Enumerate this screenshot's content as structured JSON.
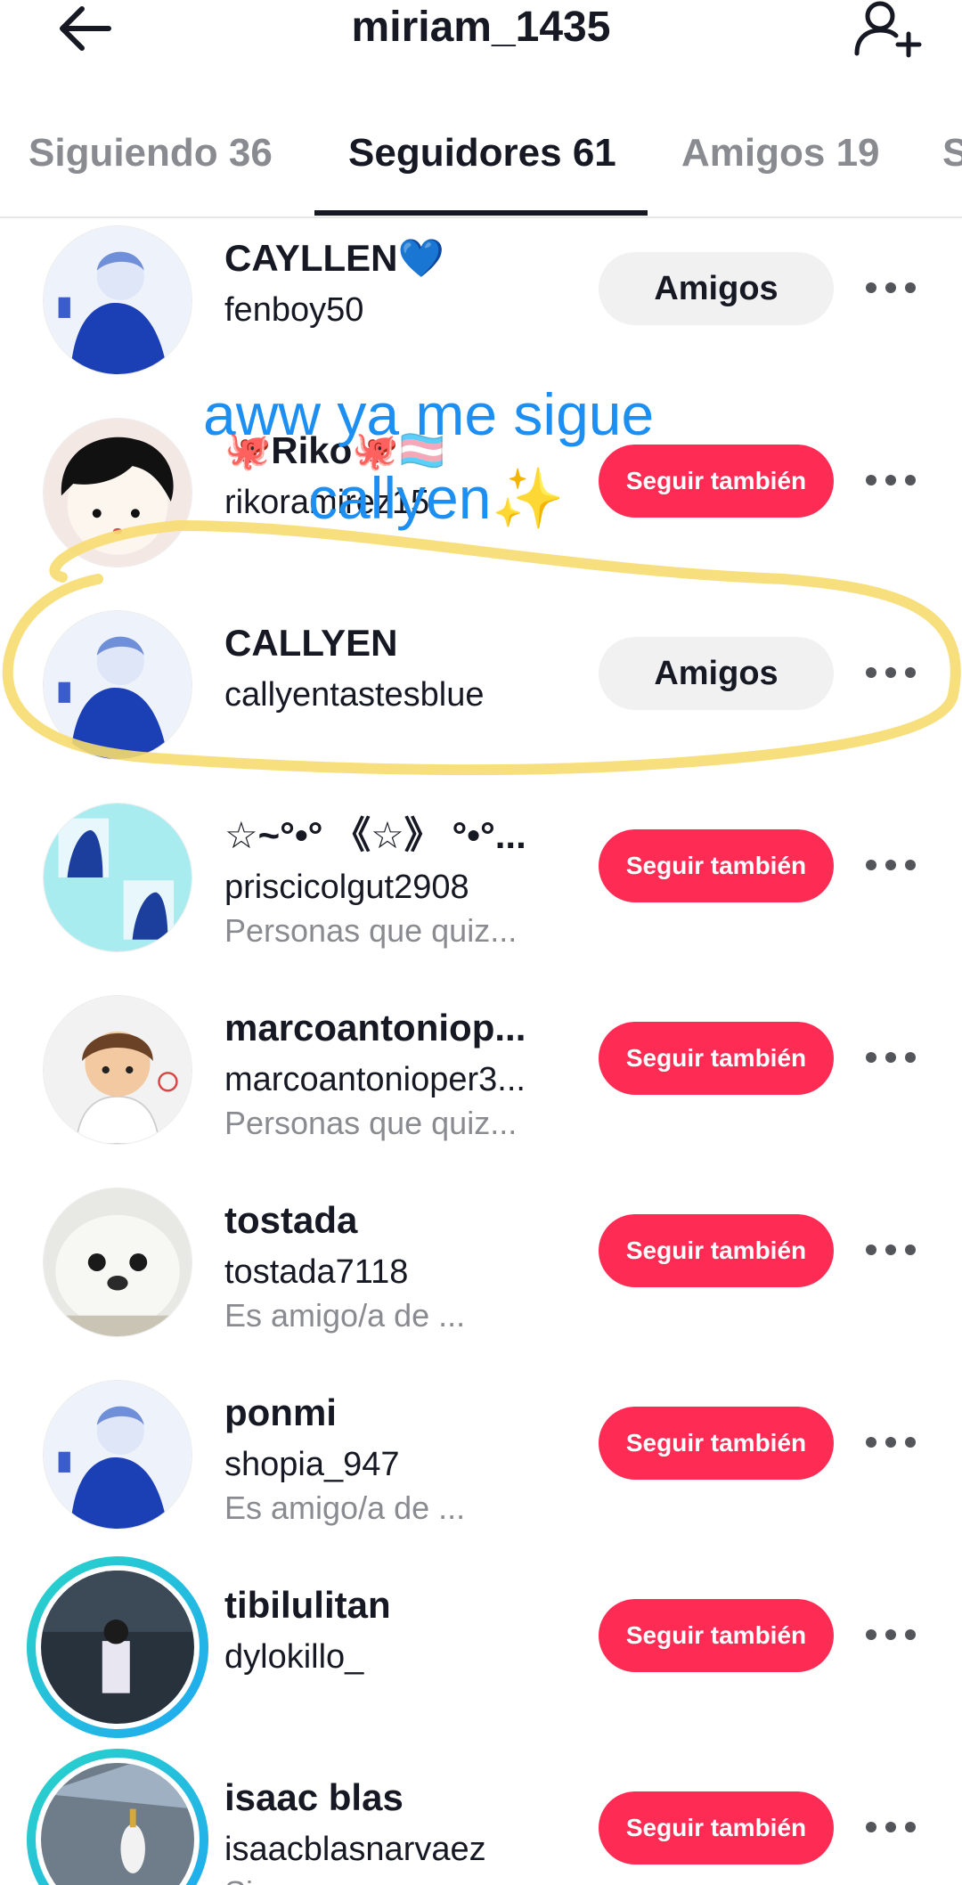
{
  "header": {
    "title": "miriam_1435"
  },
  "tabs": [
    {
      "label": "Siguiendo 36"
    },
    {
      "label": "Seguidores 61"
    },
    {
      "label": "Amigos 19"
    },
    {
      "label": "S"
    }
  ],
  "active_tab": "Seguidores 61",
  "overlay": {
    "caption_line1": "aww ya me sigue",
    "caption_line2": "callyen✨"
  },
  "rows": [
    {
      "name": "CAYLLEN💙",
      "username": "fenboy50",
      "sub": "",
      "button": "Amigos"
    },
    {
      "name": "🐙Riko🐙🏳️‍⚧️",
      "username": "rikoramirez15",
      "sub": "",
      "button": "Seguir también"
    },
    {
      "name": "CALLYEN",
      "username": "callyentastesblue",
      "sub": "",
      "button": "Amigos"
    },
    {
      "name": "☆~°•° 《☆》 °•°...",
      "username": "priscicolgut2908",
      "sub": "Personas que quiz...",
      "button": "Seguir también"
    },
    {
      "name": "marcoantoniop...",
      "username": "marcoantonioper3...",
      "sub": "Personas que quiz...",
      "button": "Seguir también"
    },
    {
      "name": "tostada",
      "username": "tostada7118",
      "sub": "Es amigo/a de ...",
      "button": "Seguir también"
    },
    {
      "name": "ponmi",
      "username": "shopia_947",
      "sub": "Es amigo/a de ...",
      "button": "Seguir también"
    },
    {
      "name": "tibilulitan",
      "username": "dylokillo_",
      "sub": "",
      "button": "Seguir también"
    },
    {
      "name": "isaac blas",
      "username": "isaacblasnarvaez",
      "sub": "Sigue a",
      "button": "Seguir también"
    }
  ],
  "colors": {
    "accent_red": "#fe2c55",
    "friends_gray": "#f1f1f2",
    "caption_blue": "#1d8ff2",
    "highlight_yellow": "#f7dc6f",
    "story_ring": "#2ad4c8"
  }
}
